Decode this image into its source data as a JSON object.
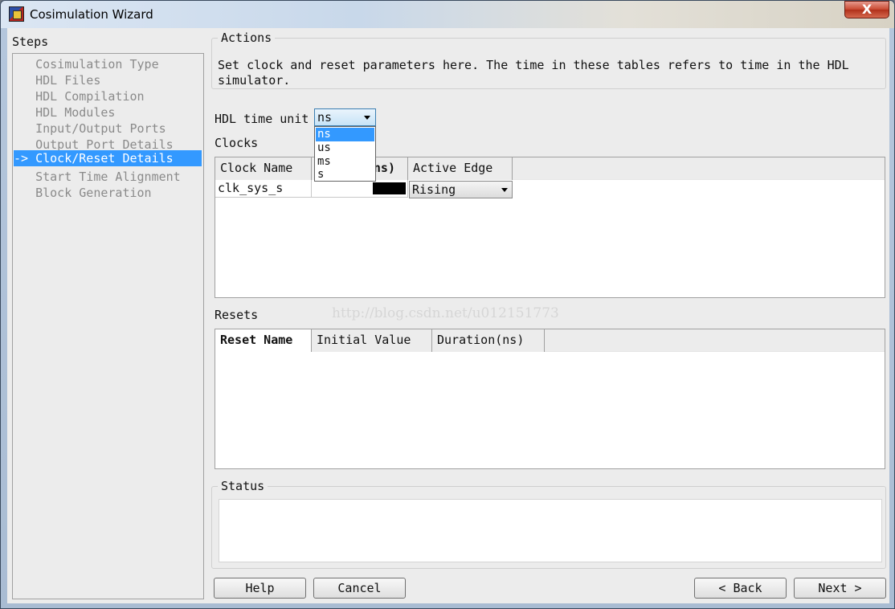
{
  "window": {
    "title": "Cosimulation Wizard",
    "close_glyph": "X"
  },
  "steps": {
    "label": "Steps",
    "items": [
      {
        "label": "   Cosimulation Type"
      },
      {
        "label": "   HDL Files"
      },
      {
        "label": "   HDL Compilation"
      },
      {
        "label": "   HDL Modules"
      },
      {
        "label": "   Input/Output Ports"
      },
      {
        "label": "   Output Port Details"
      },
      {
        "label": "-> Clock/Reset Details"
      },
      {
        "label": "   Start Time Alignment"
      },
      {
        "label": "   Block Generation"
      }
    ],
    "active_index": 6
  },
  "actions": {
    "title": "Actions",
    "text": "Set clock and reset parameters here. The time in these tables refers to time in the HDL simulator."
  },
  "time_unit": {
    "label": "HDL time unit",
    "value": "ns",
    "options": [
      "ns",
      "us",
      "ms",
      "s"
    ]
  },
  "clocks": {
    "label": "Clocks",
    "headers": [
      "Clock Name",
      "ns)",
      "Active Edge"
    ],
    "rows": [
      {
        "name": "clk_sys_s",
        "edge": "Rising"
      }
    ]
  },
  "resets": {
    "label": "Resets",
    "headers": [
      "Reset Name",
      "Initial Value",
      "Duration(ns)"
    ]
  },
  "watermark": "http://blog.csdn.net/u012151773",
  "status": {
    "title": "Status"
  },
  "buttons": {
    "help": "Help",
    "cancel": "Cancel",
    "back": "< Back",
    "next": "Next >"
  },
  "colors": {
    "selection": "#3399ff",
    "background": "#ececec"
  }
}
